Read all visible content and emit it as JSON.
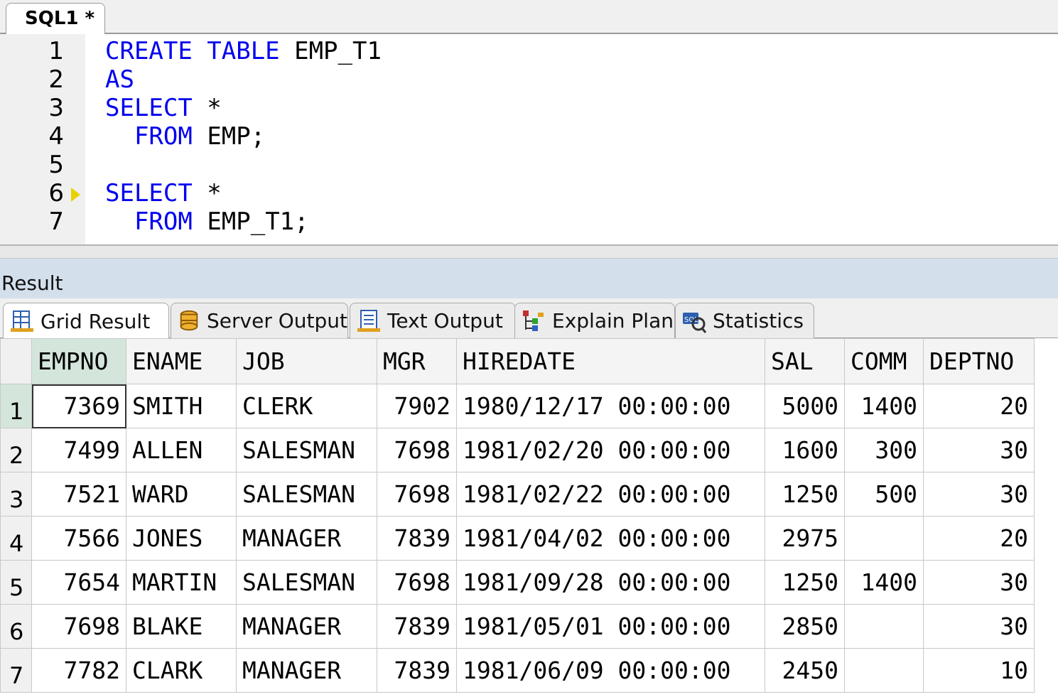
{
  "editor": {
    "tab_label": "SQL1 *",
    "lines": [
      {
        "no": "1",
        "kw": "CREATE TABLE",
        "rest": " EMP_T1",
        "indent": ""
      },
      {
        "no": "2",
        "kw": "AS",
        "rest": "",
        "indent": ""
      },
      {
        "no": "3",
        "kw": "SELECT",
        "rest": " *",
        "indent": ""
      },
      {
        "no": "4",
        "kw": "FROM",
        "rest": " EMP;",
        "indent": "  "
      },
      {
        "no": "5",
        "kw": "",
        "rest": "",
        "indent": ""
      },
      {
        "no": "6",
        "kw": "SELECT",
        "rest": " *",
        "indent": ""
      },
      {
        "no": "7",
        "kw": "FROM",
        "rest": " EMP_T1;",
        "indent": "  "
      }
    ],
    "keyword_color": "#0000ee",
    "exec_marker_line": "6"
  },
  "result": {
    "title": "Result",
    "tabs": [
      {
        "label": "Grid Result",
        "icon": "grid-result-icon",
        "active": true
      },
      {
        "label": "Server Output",
        "icon": "server-output-icon",
        "active": false
      },
      {
        "label": "Text Output",
        "icon": "text-output-icon",
        "active": false
      },
      {
        "label": "Explain Plan",
        "icon": "explain-plan-icon",
        "active": false
      },
      {
        "label": "Statistics",
        "icon": "statistics-icon",
        "active": false
      }
    ],
    "columns": [
      "EMPNO",
      "ENAME",
      "JOB",
      "MGR",
      "HIREDATE",
      "SAL",
      "COMM",
      "DEPTNO"
    ],
    "rows": [
      {
        "n": "1",
        "cells": [
          "7369",
          "SMITH",
          "CLERK",
          "7902",
          "1980/12/17 00:00:00",
          "5000",
          "1400",
          "20"
        ]
      },
      {
        "n": "2",
        "cells": [
          "7499",
          "ALLEN",
          "SALESMAN",
          "7698",
          "1981/02/20 00:00:00",
          "1600",
          "300",
          "30"
        ]
      },
      {
        "n": "3",
        "cells": [
          "7521",
          "WARD",
          "SALESMAN",
          "7698",
          "1981/02/22 00:00:00",
          "1250",
          "500",
          "30"
        ]
      },
      {
        "n": "4",
        "cells": [
          "7566",
          "JONES",
          "MANAGER",
          "7839",
          "1981/04/02 00:00:00",
          "2975",
          "",
          "20"
        ]
      },
      {
        "n": "5",
        "cells": [
          "7654",
          "MARTIN",
          "SALESMAN",
          "7698",
          "1981/09/28 00:00:00",
          "1250",
          "1400",
          "30"
        ]
      },
      {
        "n": "6",
        "cells": [
          "7698",
          "BLAKE",
          "MANAGER",
          "7839",
          "1981/05/01 00:00:00",
          "2850",
          "",
          "30"
        ]
      },
      {
        "n": "7",
        "cells": [
          "7782",
          "CLARK",
          "MANAGER",
          "7839",
          "1981/06/09 00:00:00",
          "2450",
          "",
          "10"
        ]
      }
    ],
    "selected_row": "1",
    "selected_col": "EMPNO"
  }
}
